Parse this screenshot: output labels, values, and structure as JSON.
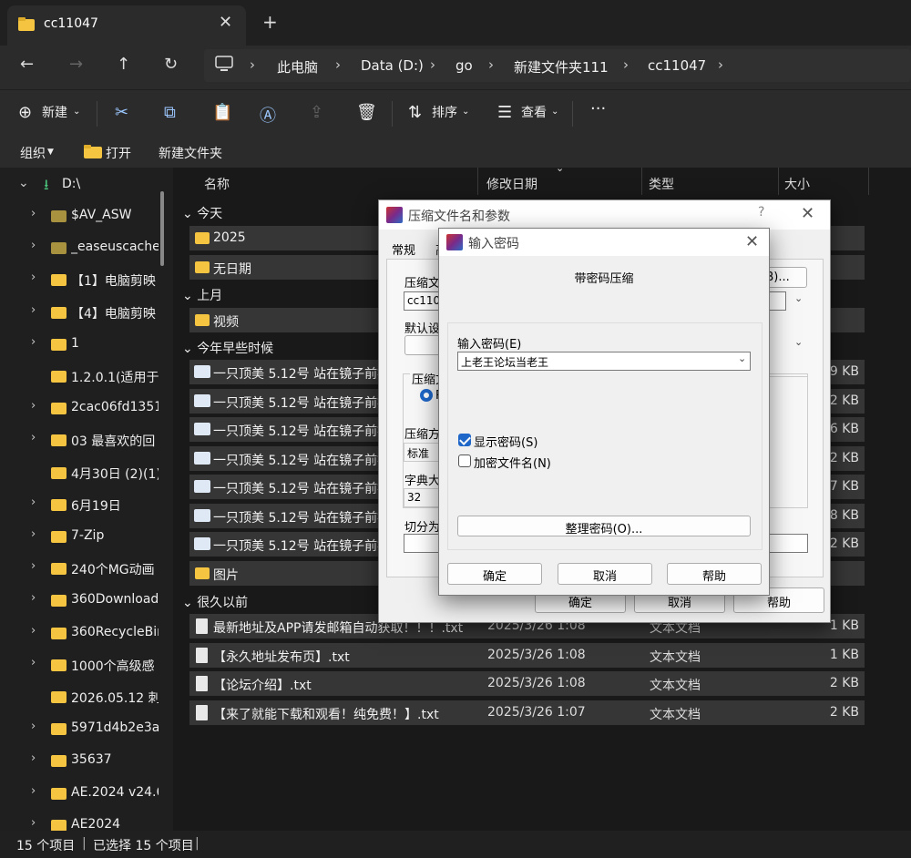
{
  "tab": {
    "title": "cc11047",
    "close": "✕"
  },
  "breadcrumb": [
    "此电脑",
    "Data (D:)",
    "go",
    "新建文件夹111",
    "cc11047"
  ],
  "toolbar": {
    "new": "新建",
    "sort": "排序",
    "view": "查看",
    "more": "···"
  },
  "subbar": {
    "organize": "组织",
    "open": "打开",
    "new_folder": "新建文件夹"
  },
  "sidebar": {
    "drive": "D:\\",
    "items": [
      "$AV_ASW",
      "_easeuscache",
      "【1】电脑剪映",
      "【4】电脑剪映",
      "1",
      "1.2.0.1(适用于C",
      "2cac06fd1351",
      "03 最喜欢的回",
      "4月30日 (2)(1)",
      "6月19日",
      "7-Zip",
      "240个MG动画",
      "360Downloads",
      "360RecycleBin",
      "1000个高级感",
      "2026.05.12 刺",
      "5971d4b2e3a",
      "35637",
      "AE.2024 v24.6",
      "AE2024"
    ]
  },
  "columns": {
    "name": "名称",
    "date": "修改日期",
    "type": "类型",
    "size": "大小"
  },
  "groups": {
    "today": "今天",
    "last_month": "上月",
    "earlier_year": "今年早些时候",
    "long_ago": "很久以前"
  },
  "folders": {
    "f2025": "2025",
    "nodate": "无日期",
    "video": "视频",
    "images": "图片"
  },
  "videos": [
    {
      "name": "一只顶美 5.12号 站在镜子前被",
      "size": "09 KB"
    },
    {
      "name": "一只顶美 5.12号 站在镜子前被",
      "size": "72 KB"
    },
    {
      "name": "一只顶美 5.12号 站在镜子前被",
      "size": "96 KB"
    },
    {
      "name": "一只顶美 5.12号 站在镜子前被",
      "size": "02 KB"
    },
    {
      "name": "一只顶美 5.12号 站在镜子前被",
      "size": "27 KB"
    },
    {
      "name": "一只顶美 5.12号 站在镜子前被",
      "size": "58 KB"
    },
    {
      "name": "一只顶美 5.12号 站在镜子前被",
      "size": "02 KB"
    }
  ],
  "textfiles": [
    {
      "name": "最新地址及APP请发邮箱自动获取！！！.txt",
      "date": "2025/3/26 1:08",
      "type": "文本文档",
      "size": "1 KB"
    },
    {
      "name": "【永久地址发布页】.txt",
      "date": "2025/3/26 1:08",
      "type": "文本文档",
      "size": "1 KB"
    },
    {
      "name": "【论坛介绍】.txt",
      "date": "2025/3/26 1:08",
      "type": "文本文档",
      "size": "2 KB"
    },
    {
      "name": "【来了就能下载和观看！纯免费！】.txt",
      "date": "2025/3/26 1:07",
      "type": "文本文档",
      "size": "2 KB"
    }
  ],
  "status": {
    "count": "15 个项目",
    "selected": "已选择 15 个项目"
  },
  "archive_dialog": {
    "title": "压缩文件名和参数",
    "help": "?",
    "tab_general": "常规",
    "tab_advanced": "高",
    "archive_name_label": "压缩文件",
    "archive_name_value": "cc1104",
    "browse": "(B)...",
    "default_settings": "默认设置",
    "format_label": "压缩文",
    "format_option": "R",
    "method_label": "压缩方式",
    "method_value": "标准",
    "dict_label": "字典大小",
    "dict_value": "32",
    "split_label": "切分为分",
    "ok": "确定",
    "cancel": "取消",
    "help_btn": "帮助"
  },
  "password_dialog": {
    "title": "输入密码",
    "heading": "带密码压缩",
    "password_label": "输入密码(E)",
    "password_value": "上老王论坛当老王",
    "show_password": "显示密码(S)",
    "encrypt_names": "加密文件名(N)",
    "organize": "整理密码(O)...",
    "ok": "确定",
    "cancel": "取消",
    "help": "帮助"
  }
}
